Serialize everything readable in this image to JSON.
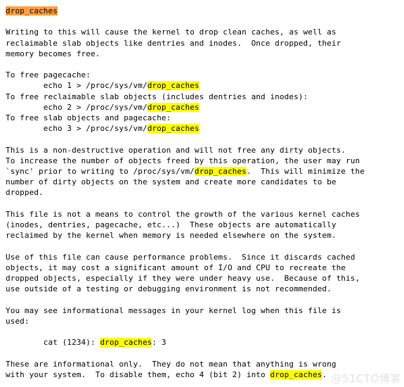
{
  "document": {
    "title": "drop_caches",
    "background_color": "#ffffff",
    "text_color": "#000000",
    "highlight_title_color": "#ff9f40",
    "highlight_term_color": "#ffff00",
    "highlighted_term": "drop_caches"
  },
  "lines": {
    "title": "drop_caches",
    "p1_l1": "Writing to this will cause the kernel to drop clean caches, as well as",
    "p1_l2": "reclaimable slab objects like dentries and inodes.  Once dropped, their",
    "p1_l3": "memory becomes free.",
    "p2_l1": "To free pagecache:",
    "p2_l2_pre": "        echo 1 > /proc/sys/vm/",
    "p2_l2_hl": "drop_caches",
    "p2_l3": "To free reclaimable slab objects (includes dentries and inodes):",
    "p2_l4_pre": "        echo 2 > /proc/sys/vm/",
    "p2_l4_hl": "drop_caches",
    "p2_l5": "To free slab objects and pagecache:",
    "p2_l6_pre": "        echo 3 > /proc/sys/vm/",
    "p2_l6_hl": "drop_caches",
    "p3_l1": "This is a non-destructive operation and will not free any dirty objects.",
    "p3_l2": "To increase the number of objects freed by this operation, the user may run",
    "p3_l3_pre": "`sync' prior to writing to /proc/sys/vm/",
    "p3_l3_hl": "drop_caches",
    "p3_l3_post": ".  This will minimize the",
    "p3_l4": "number of dirty objects on the system and create more candidates to be",
    "p3_l5": "dropped.",
    "p4_l1": "This file is not a means to control the growth of the various kernel caches",
    "p4_l2": "(inodes, dentries, pagecache, etc...)  These objects are automatically",
    "p4_l3": "reclaimed by the kernel when memory is needed elsewhere on the system.",
    "p5_l1": "Use of this file can cause performance problems.  Since it discards cached",
    "p5_l2": "objects, it may cost a significant amount of I/O and CPU to recreate the",
    "p5_l3": "dropped objects, especially if they were under heavy use.  Because of this,",
    "p5_l4": "use outside of a testing or debugging environment is not recommended.",
    "p6_l1": "You may see informational messages in your kernel log when this file is",
    "p6_l2": "used:",
    "p7_l1_pre": "        cat (1234): ",
    "p7_l1_hl": "drop_caches",
    "p7_l1_post": ": 3",
    "p8_l1": "These are informational only.  They do not mean that anything is wrong",
    "p8_l2_pre": "with your system.  To disable them, echo 4 (bit 2) into ",
    "p8_l2_hl": "drop_caches",
    "p8_l2_post": "."
  },
  "watermark": {
    "text": "@51CTO博客"
  }
}
